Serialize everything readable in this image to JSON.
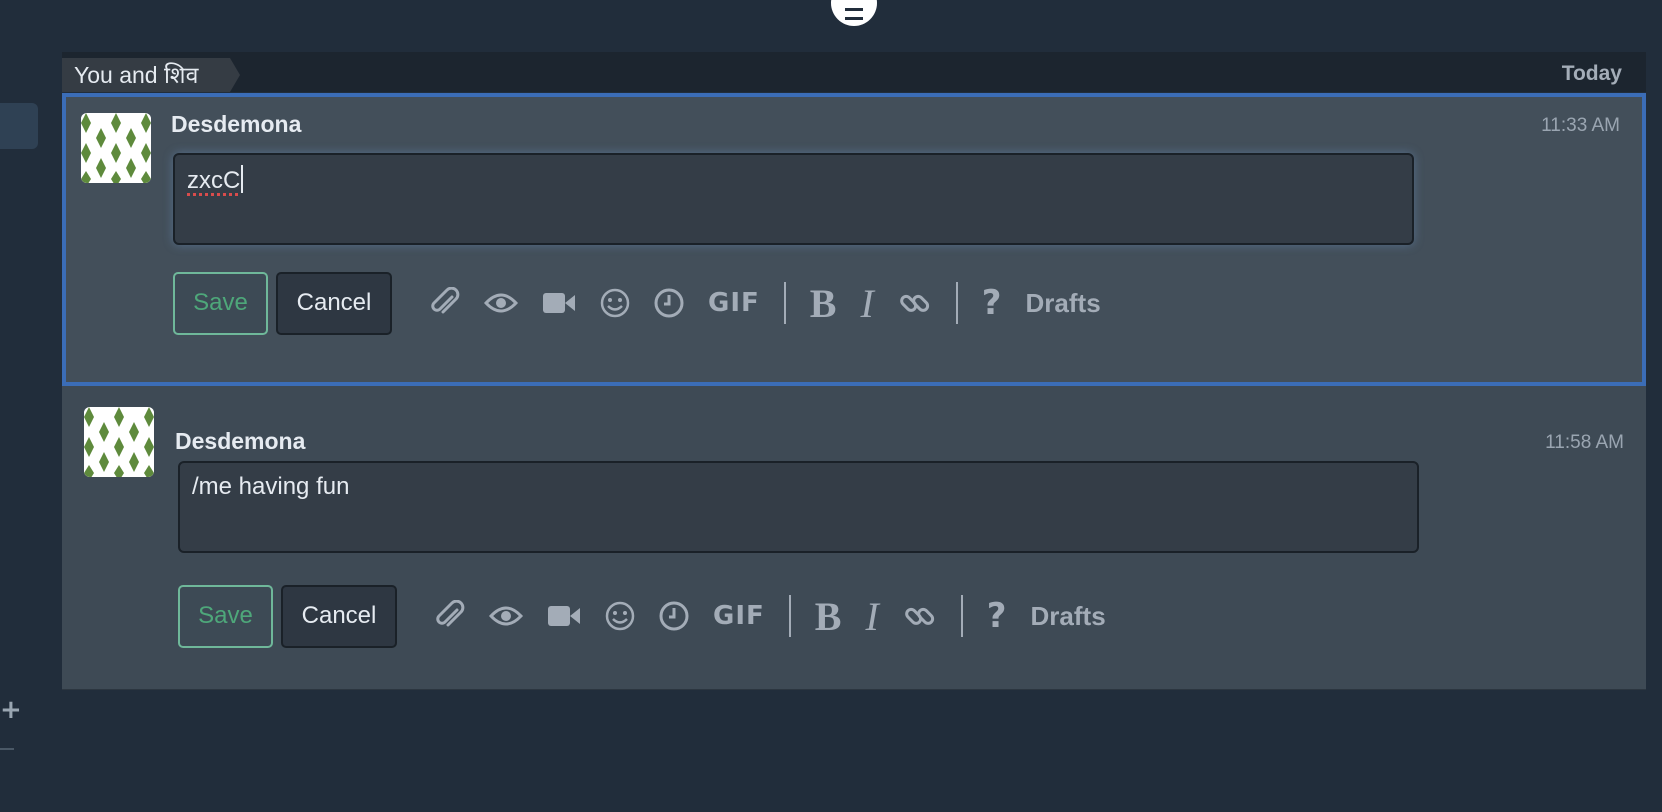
{
  "recipient": {
    "label": "You and शिव",
    "date": "Today"
  },
  "messages": [
    {
      "sender": "Desdemona",
      "time": "11:33 AM",
      "edit_value": "zxcC",
      "save_label": "Save",
      "cancel_label": "Cancel",
      "drafts_label": "Drafts",
      "active": true
    },
    {
      "sender": "Desdemona",
      "time": "11:58 AM",
      "edit_value": "/me having fun",
      "save_label": "Save",
      "cancel_label": "Cancel",
      "drafts_label": "Drafts",
      "active": false
    }
  ],
  "toolbar": {
    "icons": [
      "attachment-icon",
      "preview-eye-icon",
      "video-call-icon",
      "emoji-icon",
      "time-icon",
      "gif-icon",
      "bold-icon",
      "italic-icon",
      "link-icon",
      "help-icon"
    ],
    "gif_label": "GIF",
    "bold_label": "B",
    "italic_label": "I",
    "help_label": "?"
  },
  "colors": {
    "active_border": "#3b6db7",
    "save_text": "#4ea77a",
    "background": "#212d3b"
  }
}
